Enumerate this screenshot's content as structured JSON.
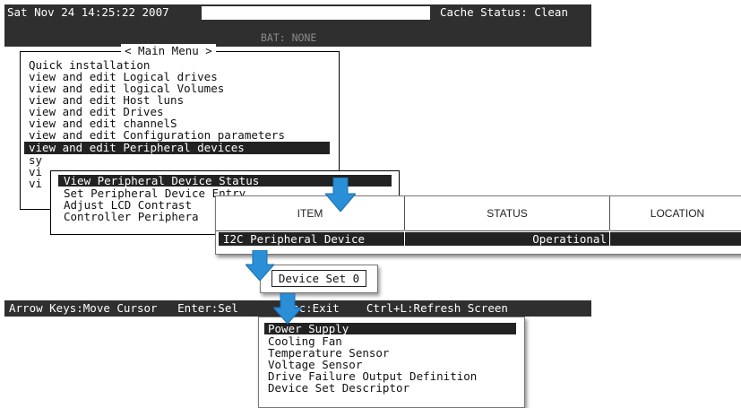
{
  "header": {
    "datetime": "Sat Nov 24 14:25:22 2007",
    "cache_status": "Cache Status: Clean",
    "battery": "BAT: NONE"
  },
  "main_menu": {
    "title": "< Main Menu >",
    "items": [
      "Quick installation",
      "view and edit Logical drives",
      "view and edit logical Volumes",
      "view and edit Host luns",
      "view and edit Drives",
      "view and edit channelS",
      "view and edit Configuration parameters",
      "view and edit Peripheral devices",
      "sy",
      "vi",
      "vi"
    ],
    "selected_index": 7
  },
  "submenu": {
    "items": [
      "View Peripheral Device Status",
      "Set Peripheral Device Entry",
      "Adjust LCD Contrast",
      "Controller Periphera"
    ],
    "selected_index": 0
  },
  "status_table": {
    "headers": [
      "ITEM",
      "STATUS",
      "LOCATION"
    ],
    "rows": [
      {
        "item": "I2C Peripheral Device",
        "status": "Operational",
        "location": ""
      }
    ]
  },
  "device_set": {
    "label": "Device Set 0"
  },
  "footer": {
    "hints": "Arrow Keys:Move Cursor   Enter:Sel       Esc:Exit    Ctrl+L:Refresh Screen"
  },
  "device_list": {
    "items": [
      "Power Supply",
      "Cooling Fan",
      "Temperature Sensor",
      "Voltage Sensor",
      "Drive Failure Output Definition",
      "Device Set Descriptor"
    ],
    "selected_index": 0
  },
  "colors": {
    "bar": "#2f2f2f",
    "arrow": "#2a8fd6",
    "highlight": "#222222"
  }
}
